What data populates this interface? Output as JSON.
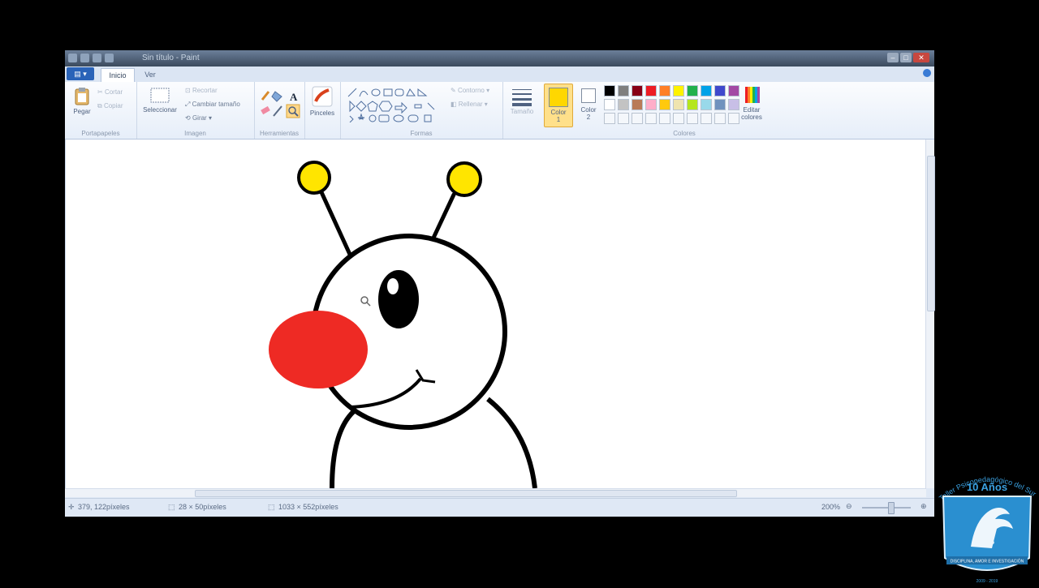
{
  "window": {
    "title": "Sin título - Paint",
    "controls": [
      "–",
      "□",
      "✕"
    ]
  },
  "tabs": [
    {
      "label": "Inicio",
      "active": true
    },
    {
      "label": "Ver",
      "active": false
    }
  ],
  "file_button": {
    "label": "▤ ▾"
  },
  "ribbon": {
    "clipboard": {
      "label": "Portapapeles",
      "paste": "Pegar",
      "cut": "Cortar",
      "copy": "Copiar"
    },
    "image": {
      "label": "Imagen",
      "select": "Seleccionar",
      "crop": "Recortar",
      "resize": "Cambiar tamaño",
      "rotate": "Girar ▾"
    },
    "tools": {
      "label": "Herramientas",
      "brushes": "Pinceles"
    },
    "shapes": {
      "label": "Formas",
      "outline": "Contorno ▾",
      "fill": "Rellenar ▾"
    },
    "size": {
      "label": "Tamaño"
    },
    "color1": {
      "label": "Color 1",
      "color": "#ffd700"
    },
    "color2": {
      "label": "Color 2",
      "color": "#ffffff"
    },
    "colors": {
      "label": "Colores",
      "edit": "Editar colores",
      "row1": [
        "#000000",
        "#7f7f7f",
        "#880015",
        "#ed1c24",
        "#ff7f27",
        "#fff200",
        "#22b14c",
        "#00a2e8",
        "#3f48cc",
        "#a349a4"
      ],
      "row2": [
        "#ffffff",
        "#c3c3c3",
        "#b97a57",
        "#ffaec9",
        "#ffc90e",
        "#efe4b0",
        "#b5e61d",
        "#99d9ea",
        "#7092be",
        "#c8bfe7"
      ]
    }
  },
  "status": {
    "cursor_pos": "379, 122píxeles",
    "selection_size": "28 × 50píxeles",
    "image_size": "1033 × 552píxeles",
    "zoom": "200%"
  },
  "drawing": {
    "nose_color": "#ee2a24",
    "antenna_color": "#ffe500",
    "outline_color": "#000000"
  },
  "logo": {
    "title": "Taller Psicopedagógico del Sur",
    "years": "10 Años",
    "motto": "DISCIPLINA, AMOR E INVESTIGACIÓN",
    "dates": "2009 - 2019",
    "color": "#2a8fd0"
  }
}
